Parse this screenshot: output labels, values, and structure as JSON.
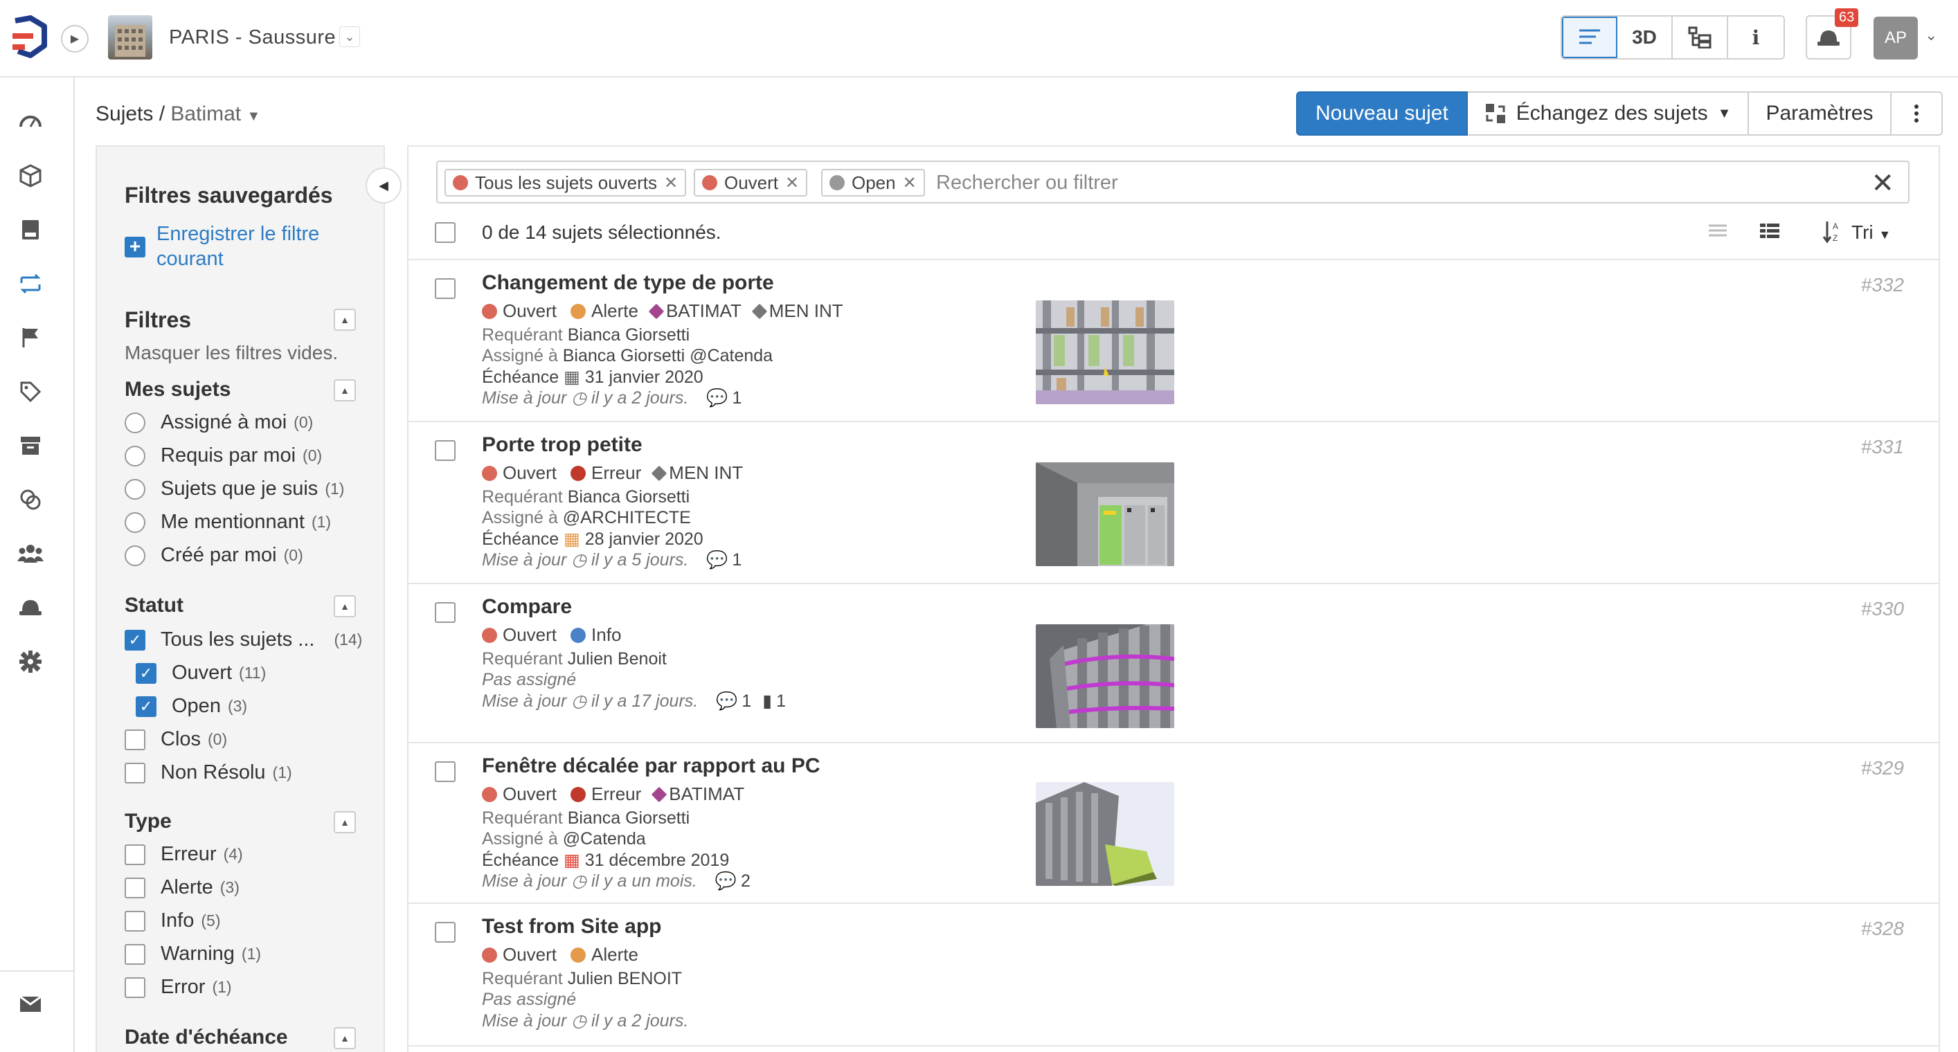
{
  "project": {
    "name": "PARIS - Saussure"
  },
  "topbar": {
    "views": [
      {
        "label": "",
        "icon": "list-icon"
      },
      {
        "label": "3D",
        "icon": ""
      },
      {
        "label": "",
        "icon": "tree-icon"
      },
      {
        "label": "i",
        "icon": ""
      }
    ],
    "notifications_count": "63",
    "avatar_initials": "AP"
  },
  "breadcrumb": {
    "root": "Sujets",
    "sep": "/",
    "current": "Batimat"
  },
  "actions": {
    "new_issue": "Nouveau sujet",
    "exchange": "Échangez des sujets",
    "settings": "Paramètres"
  },
  "filters": {
    "saved_title": "Filtres sauvegardés",
    "save_link": "Enregistrer le filtre courant",
    "title": "Filtres",
    "hide_empty": "Masquer les filtres vides.",
    "my_issues": {
      "title": "Mes sujets",
      "items": [
        {
          "label": "Assigné à moi",
          "count": "(0)"
        },
        {
          "label": "Requis par moi",
          "count": "(0)"
        },
        {
          "label": "Sujets que je suis",
          "count": "(1)"
        },
        {
          "label": "Me mentionnant",
          "count": "(1)"
        },
        {
          "label": "Créé par moi",
          "count": "(0)"
        }
      ]
    },
    "status": {
      "title": "Statut",
      "items": [
        {
          "label": "Tous les sujets ...",
          "count": "(14)",
          "checked": true
        },
        {
          "label": "Ouvert",
          "count": "(11)",
          "checked": true
        },
        {
          "label": "Open",
          "count": "(3)",
          "checked": true
        },
        {
          "label": "Clos",
          "count": "(0)",
          "checked": false
        },
        {
          "label": "Non Résolu",
          "count": "(1)",
          "checked": false
        }
      ]
    },
    "type": {
      "title": "Type",
      "items": [
        {
          "label": "Erreur",
          "count": "(4)"
        },
        {
          "label": "Alerte",
          "count": "(3)"
        },
        {
          "label": "Info",
          "count": "(5)"
        },
        {
          "label": "Warning",
          "count": "(1)"
        },
        {
          "label": "Error",
          "count": "(1)"
        }
      ]
    },
    "due_date": {
      "title": "Date d'échéance"
    }
  },
  "search": {
    "tags": [
      {
        "label": "Tous les sujets ouverts",
        "color": "#d9685a"
      },
      {
        "label": "Ouvert",
        "color": "#d9685a"
      },
      {
        "label": "Open",
        "color": "#999999"
      }
    ],
    "placeholder": "Rechercher ou filtrer"
  },
  "list": {
    "selection": "0 de 14 sujets sélectionnés.",
    "sort_label": "Tri"
  },
  "issues": [
    {
      "title": "Changement de type de porte",
      "number": "#332",
      "status": "Ouvert",
      "type": "Alerte",
      "labels": [
        "BATIMAT",
        "MEN INT"
      ],
      "requester_label": "Requérant",
      "requester": "Bianca Giorsetti",
      "assigned_label": "Assigné à",
      "assigned": "Bianca Giorsetti @Catenda",
      "due_label": "Échéance",
      "due": "31 janvier 2020",
      "updated_label": "Mise à jour",
      "updated": "il y a 2 jours.",
      "comments": "1"
    },
    {
      "title": "Porte trop petite",
      "number": "#331",
      "status": "Ouvert",
      "type": "Erreur",
      "labels": [
        "MEN INT"
      ],
      "requester_label": "Requérant",
      "requester": "Bianca Giorsetti",
      "assigned_label": "Assigné à",
      "assigned": "@ARCHITECTE",
      "due_label": "Échéance",
      "due": "28 janvier 2020",
      "updated_label": "Mise à jour",
      "updated": "il y a 5 jours.",
      "comments": "1"
    },
    {
      "title": "Compare",
      "number": "#330",
      "status": "Ouvert",
      "type": "Info",
      "requester_label": "Requérant",
      "requester": "Julien Benoit",
      "unassigned": "Pas assigné",
      "updated_label": "Mise à jour",
      "updated": "il y a 17 jours.",
      "comments": "1",
      "docs": "1"
    },
    {
      "title": "Fenêtre décalée par rapport au PC",
      "number": "#329",
      "status": "Ouvert",
      "type": "Erreur",
      "labels": [
        "BATIMAT"
      ],
      "requester_label": "Requérant",
      "requester": "Bianca Giorsetti",
      "assigned_label": "Assigné à",
      "assigned": "@Catenda",
      "due_label": "Échéance",
      "due": "31 décembre 2019",
      "updated_label": "Mise à jour",
      "updated": "il y a un mois.",
      "comments": "2"
    },
    {
      "title": "Test from Site app",
      "number": "#328",
      "status": "Ouvert",
      "type": "Alerte",
      "requester_label": "Requérant",
      "requester": "Julien BENOIT",
      "unassigned": "Pas assigné",
      "updated_label": "Mise à jour",
      "updated": "il y a 2 jours."
    }
  ],
  "colors": {
    "accent": "#2d7bc4",
    "status_open": "#d9685a",
    "type_alert": "#e59a4a",
    "type_error": "#c0392b",
    "type_info": "#4a82c8",
    "label": "#a3468f"
  }
}
